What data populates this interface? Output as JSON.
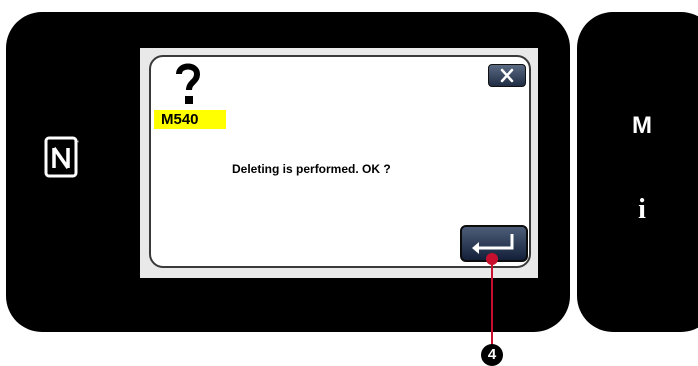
{
  "side_panel": {
    "m_label": "M",
    "i_label": "i"
  },
  "dialog": {
    "code": "M540",
    "message": "Deleting is performed. OK ?",
    "icon": "question-mark-icon",
    "close_icon": "close-icon",
    "enter_icon": "enter-icon"
  },
  "callout": {
    "number": "4"
  },
  "colors": {
    "code_badge": "#ffff00",
    "callout": "#c8102e",
    "button": "#1f2c44"
  }
}
